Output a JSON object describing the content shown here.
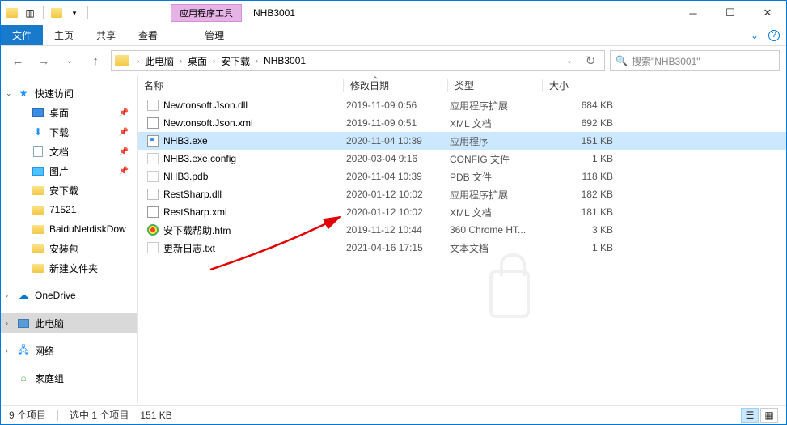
{
  "window": {
    "contextualTab": "应用程序工具",
    "title": "NHB3001"
  },
  "ribbon": {
    "file": "文件",
    "tabs": [
      "主页",
      "共享",
      "查看"
    ],
    "manage": "管理"
  },
  "address": {
    "segments": [
      "此电脑",
      "桌面",
      "安下载",
      "NHB3001"
    ]
  },
  "search": {
    "placeholder": "搜索\"NHB3001\""
  },
  "nav": {
    "quick": "快速访问",
    "desktop": "桌面",
    "downloads": "下载",
    "documents": "文档",
    "pictures": "图片",
    "anxiazai": "安下载",
    "n71521": "71521",
    "baidu": "BaiduNetdiskDow",
    "anzhuang": "安装包",
    "newfolder": "新建文件夹",
    "onedrive": "OneDrive",
    "thispc": "此电脑",
    "network": "网络",
    "homegroup": "家庭组"
  },
  "columns": {
    "name": "名称",
    "date": "修改日期",
    "type": "类型",
    "size": "大小"
  },
  "files": [
    {
      "name": "Newtonsoft.Json.dll",
      "date": "2019-11-09 0:56",
      "type": "应用程序扩展",
      "size": "684 KB",
      "ico": "dll"
    },
    {
      "name": "Newtonsoft.Json.xml",
      "date": "2019-11-09 0:51",
      "type": "XML 文档",
      "size": "692 KB",
      "ico": "xml"
    },
    {
      "name": "NHB3.exe",
      "date": "2020-11-04 10:39",
      "type": "应用程序",
      "size": "151 KB",
      "ico": "exe",
      "selected": true
    },
    {
      "name": "NHB3.exe.config",
      "date": "2020-03-04 9:16",
      "type": "CONFIG 文件",
      "size": "1 KB",
      "ico": "cfg"
    },
    {
      "name": "NHB3.pdb",
      "date": "2020-11-04 10:39",
      "type": "PDB 文件",
      "size": "118 KB",
      "ico": "pdb"
    },
    {
      "name": "RestSharp.dll",
      "date": "2020-01-12 10:02",
      "type": "应用程序扩展",
      "size": "182 KB",
      "ico": "dll"
    },
    {
      "name": "RestSharp.xml",
      "date": "2020-01-12 10:02",
      "type": "XML 文档",
      "size": "181 KB",
      "ico": "xml"
    },
    {
      "name": "安下载帮助.htm",
      "date": "2019-11-12 10:44",
      "type": "360 Chrome HT...",
      "size": "3 KB",
      "ico": "htm"
    },
    {
      "name": "更新日志.txt",
      "date": "2021-04-16 17:15",
      "type": "文本文档",
      "size": "1 KB",
      "ico": "txt"
    }
  ],
  "status": {
    "count": "9 个项目",
    "selected": "选中 1 个项目",
    "size": "151 KB"
  }
}
